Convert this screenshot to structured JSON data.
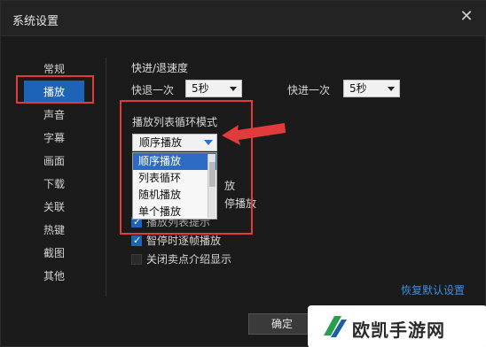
{
  "window": {
    "title": "系统设置",
    "close_icon": "close-icon"
  },
  "sidebar": {
    "items": [
      {
        "label": "常规"
      },
      {
        "label": "播放",
        "active": true
      },
      {
        "label": "声音"
      },
      {
        "label": "字幕"
      },
      {
        "label": "画面"
      },
      {
        "label": "下载"
      },
      {
        "label": "关联"
      },
      {
        "label": "热键"
      },
      {
        "label": "截图"
      },
      {
        "label": "其他"
      }
    ]
  },
  "speed": {
    "section_label": "快进/退速度",
    "back_label": "快退一次",
    "back_value": "5秒",
    "forward_label": "快进一次",
    "forward_value": "5秒"
  },
  "loop_mode": {
    "label": "播放列表循环模式",
    "selected": "顺序播放",
    "options": [
      "顺序播放",
      "列表循环",
      "随机播放",
      "单个播放"
    ]
  },
  "hidden_fragments": {
    "frag1": "放",
    "frag2": "停播放",
    "frag3": "播放列表提示"
  },
  "options": {
    "opt1": {
      "label": "智停时逐帧播放",
      "checked": true
    },
    "opt2": {
      "label": "关闭卖点介绍显示",
      "checked": false
    },
    "opt0": {
      "checked": true
    }
  },
  "restore_default": "恢复默认设置",
  "ok_button": "确定",
  "watermark_text": "欧凯手游网",
  "colors": {
    "accent": "#1d63b7",
    "highlight_red": "#e23b3b",
    "link": "#3a8fe6"
  }
}
